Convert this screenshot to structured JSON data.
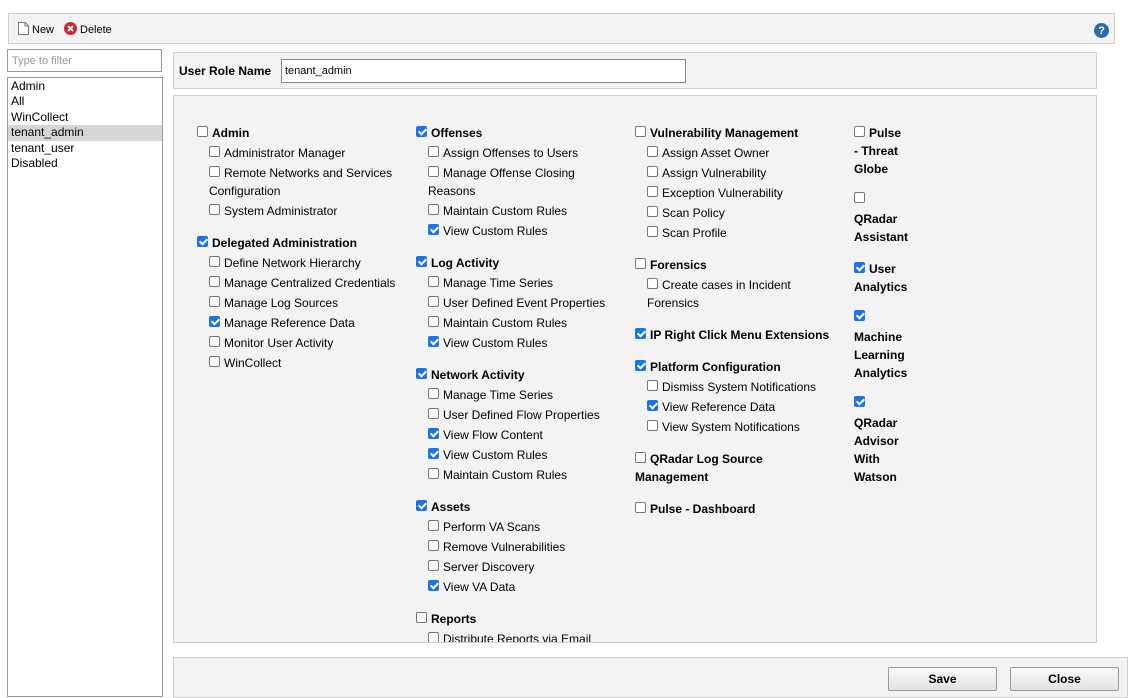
{
  "toolbar": {
    "new_label": "New",
    "delete_label": "Delete",
    "help_label": "?"
  },
  "filter": {
    "placeholder": "Type to filter"
  },
  "roles": [
    "Admin",
    "All",
    "WinCollect",
    "tenant_admin",
    "tenant_user",
    "Disabled"
  ],
  "selected_role": "tenant_admin",
  "role_name": {
    "label": "User Role Name",
    "value": "tenant_admin"
  },
  "permissions": [
    {
      "text": "Admin",
      "checked": false,
      "category": true
    },
    {
      "text": "Administrator Manager",
      "checked": false
    },
    {
      "text": "Remote Networks and Services",
      "checked": false
    },
    {
      "text": "Configuration"
    },
    {
      "text": "System Administrator",
      "checked": false
    },
    {
      "text": "Delegated Administration",
      "checked": true,
      "category": true
    },
    {
      "text": "Define Network Hierarchy",
      "checked": false
    },
    {
      "text": "Manage Centralized Credentials",
      "checked": false
    },
    {
      "text": "Manage Log Sources",
      "checked": false
    },
    {
      "text": "Manage Reference Data",
      "checked": true
    },
    {
      "text": "Monitor User Activity",
      "checked": false
    },
    {
      "text": "WinCollect",
      "checked": false
    },
    {
      "text": "Offenses",
      "checked": true,
      "category": true
    },
    {
      "text": "Assign Offenses to Users",
      "checked": false
    },
    {
      "text": "Manage Offense Closing",
      "checked": false
    },
    {
      "text": "Reasons"
    },
    {
      "text": "Maintain Custom Rules",
      "checked": false
    },
    {
      "text": "View Custom Rules",
      "checked": true
    },
    {
      "text": "Log Activity",
      "checked": true,
      "category": true
    },
    {
      "text": "Manage Time Series",
      "checked": false
    },
    {
      "text": "User Defined Event Properties",
      "checked": false
    },
    {
      "text": "Maintain Custom Rules",
      "checked": false
    },
    {
      "text": "View Custom Rules",
      "checked": true
    },
    {
      "text": "Network Activity",
      "checked": true,
      "category": true
    },
    {
      "text": "Manage Time Series",
      "checked": false
    },
    {
      "text": "User Defined Flow Properties",
      "checked": false
    },
    {
      "text": "View Flow Content",
      "checked": true
    },
    {
      "text": "View Custom Rules",
      "checked": true
    },
    {
      "text": "Maintain Custom Rules",
      "checked": false
    },
    {
      "text": "Assets",
      "checked": true,
      "category": true
    },
    {
      "text": "Perform VA Scans",
      "checked": false
    },
    {
      "text": "Remove Vulnerabilities",
      "checked": false
    },
    {
      "text": "Server Discovery",
      "checked": false
    },
    {
      "text": "View VA Data",
      "checked": true
    },
    {
      "text": "Reports",
      "checked": false,
      "category": true
    },
    {
      "text": "Distribute Reports via Email",
      "checked": false
    },
    {
      "text": "Vulnerability Management",
      "checked": false,
      "category": true
    },
    {
      "text": "Assign Asset Owner",
      "checked": false
    },
    {
      "text": "Assign Vulnerability",
      "checked": false
    },
    {
      "text": "Exception Vulnerability",
      "checked": false
    },
    {
      "text": "Scan Policy",
      "checked": false
    },
    {
      "text": "Scan Profile",
      "checked": false
    },
    {
      "text": "Forensics",
      "checked": false,
      "category": true
    },
    {
      "text": "Create cases in Incident",
      "checked": false
    },
    {
      "text": "Forensics"
    },
    {
      "text": "IP Right Click Menu Extensions",
      "checked": true,
      "category": true
    },
    {
      "text": "Platform Configuration",
      "checked": true,
      "category": true
    },
    {
      "text": "Dismiss System Notifications",
      "checked": false
    },
    {
      "text": "View Reference Data",
      "checked": true
    },
    {
      "text": "View System Notifications",
      "checked": false
    },
    {
      "text": "QRadar Log Source",
      "checked": false,
      "category": true
    },
    {
      "text": "Management",
      "category": true
    },
    {
      "text": "Pulse - Dashboard",
      "checked": false,
      "category": true
    },
    {
      "text": "Pulse",
      "checked": false,
      "category": true
    },
    {
      "text": "- Threat",
      "category": true
    },
    {
      "text": "Globe",
      "category": true
    },
    {
      "text": "",
      "checked": false
    },
    {
      "text": "QRadar",
      "category": true
    },
    {
      "text": "Assistant",
      "category": true
    },
    {
      "text": "User",
      "checked": true,
      "category": true
    },
    {
      "text": "Analytics",
      "category": true
    },
    {
      "text": "",
      "checked": true
    },
    {
      "text": "Machine",
      "category": true
    },
    {
      "text": "Learning",
      "category": true
    },
    {
      "text": "Analytics",
      "category": true
    },
    {
      "text": "",
      "checked": true
    },
    {
      "text": "QRadar",
      "category": true
    },
    {
      "text": "Advisor",
      "category": true
    },
    {
      "text": "With",
      "category": true
    },
    {
      "text": "Watson",
      "category": true
    }
  ],
  "footer": {
    "save_label": "Save",
    "close_label": "Close"
  }
}
